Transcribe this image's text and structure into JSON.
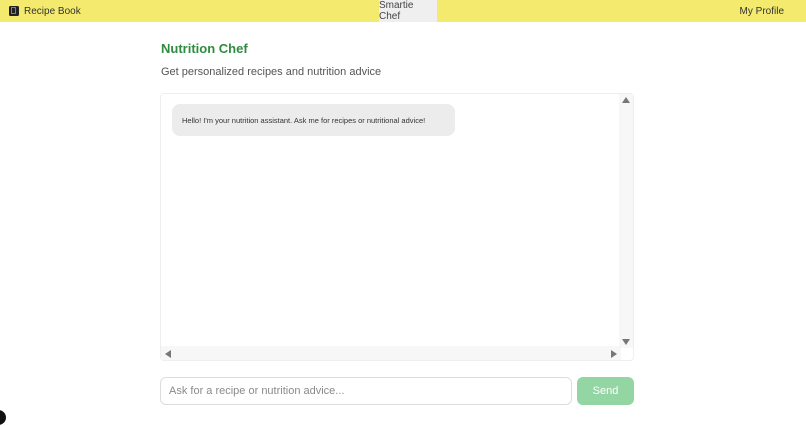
{
  "nav": {
    "left_label": "Recipe Book",
    "left_icon": "book-icon",
    "center_label": "Smartie Chef",
    "right_label": "My Profile",
    "bar_color": "#f4ea6e"
  },
  "main": {
    "title": "Nutrition Chef",
    "subtitle": "Get personalized recipes and nutrition advice",
    "title_color": "#2f8b3f"
  },
  "chat": {
    "messages": [
      {
        "from": "assistant",
        "text": "Hello! I'm your nutrition assistant. Ask me for recipes or nutritional advice!"
      }
    ]
  },
  "composer": {
    "placeholder": "Ask for a recipe or nutrition advice...",
    "send_label": "Send",
    "send_color": "#93d6a3"
  }
}
